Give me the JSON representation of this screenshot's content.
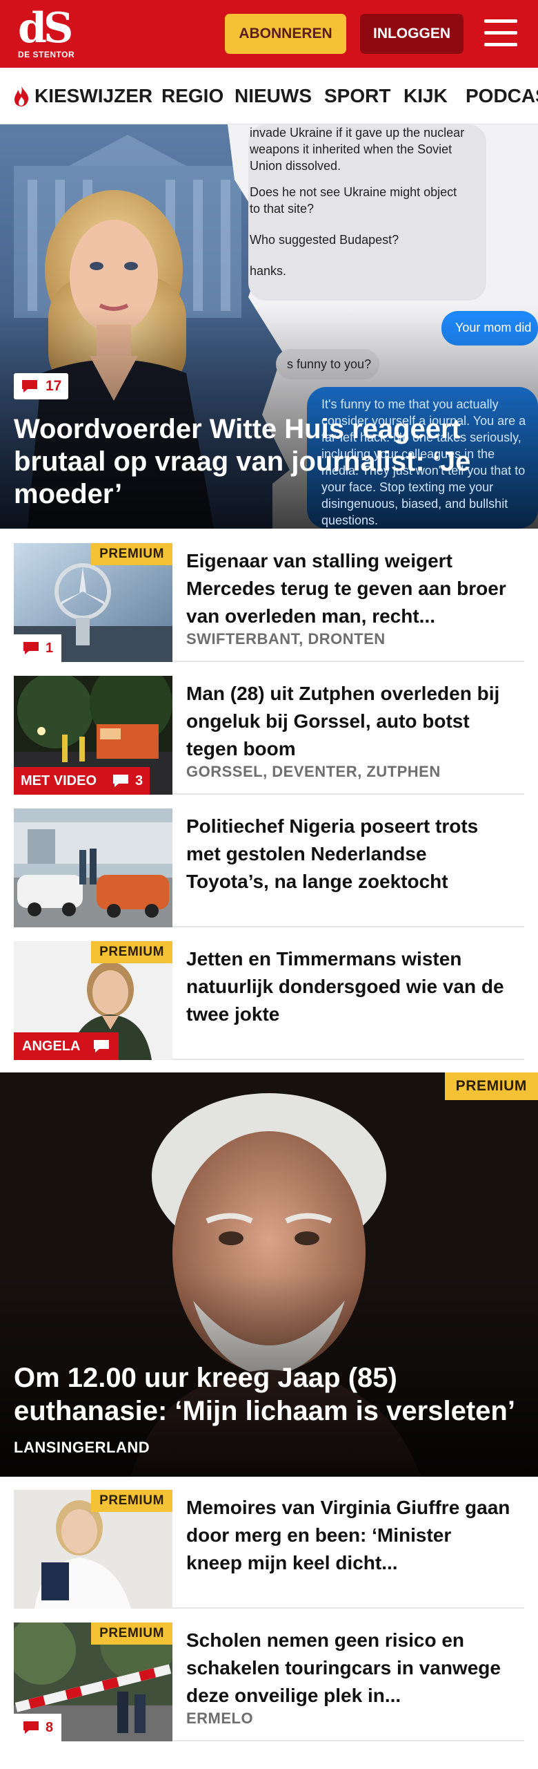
{
  "header": {
    "logo": "dS",
    "logo_sub": "DE STENTOR",
    "subscribe_label": "ABONNEREN",
    "login_label": "INLOGGEN",
    "menu_icon": "hamburger-icon"
  },
  "nav": {
    "items": [
      "KIESWIJZER",
      "REGIO",
      "NIEUWS",
      "SPORT",
      "KIJK",
      "PODCAST"
    ],
    "first_icon": "flame-icon"
  },
  "colors": {
    "brand_red": "#d2111b",
    "dark_red": "#8e0a10",
    "premium_yellow": "#f6c235"
  },
  "hero1": {
    "comment_count": "17",
    "title": "Woordvoerder Witte Huis reageert brutaal op vraag van journalist: ‘Je moeder’",
    "chat_lines": {
      "m1": "invade Ukraine if it gave up the nuclear weapons it inherited when the Soviet Union dissolved.",
      "m2": "Does he not see Ukraine might object to that site?",
      "m3": "Who suggested Budapest?",
      "m4": "hanks.",
      "reply1": "Your mom did",
      "m5": "s funny to you?",
      "reply2": "It's funny to me that you actually consider yourself a journal. You are a far-left hack. No one takes seriously, including your colleagues in the media. They just won't tell you that to your face. Stop texting me your disingenuous, biased, and bullshit questions."
    }
  },
  "articles": [
    {
      "premium": "PREMIUM",
      "title": "Eigenaar van stalling weigert Mercedes terug te geven aan broer van overleden man, recht...",
      "location": "SWIFTERBANT, DRONTEN",
      "comments": "1"
    },
    {
      "video_label": "MET VIDEO",
      "title": "Man (28) uit Zutphen overleden bij ongeluk bij Gorssel, auto botst tegen boom",
      "location": "GORSSEL, DEVENTER, ZUTPHEN",
      "comments": "3"
    },
    {
      "title": "Politiechef Nigeria poseert trots met gestolen Nederlandse Toyota’s, na lange zoektocht"
    },
    {
      "premium": "PREMIUM",
      "author_label": "ANGELA",
      "title": "Jetten en Timmermans wisten natuurlijk dondersgoed wie van de twee jokte"
    }
  ],
  "hero2": {
    "premium": "PREMIUM",
    "title": "Om 12.00 uur kreeg Jaap (85) euthanasie: ‘Mijn lichaam is versleten’",
    "location": "LANSINGERLAND"
  },
  "articles2": [
    {
      "premium": "PREMIUM",
      "title": "Memoires van Virginia Giuffre gaan door merg en been: ‘Minister kneep mijn keel dicht..."
    },
    {
      "premium": "PREMIUM",
      "title": "Scholen nemen geen risico en schakelen touringcars in vanwege deze onveilige plek in...",
      "location": "ERMELO",
      "comments": "8"
    }
  ]
}
